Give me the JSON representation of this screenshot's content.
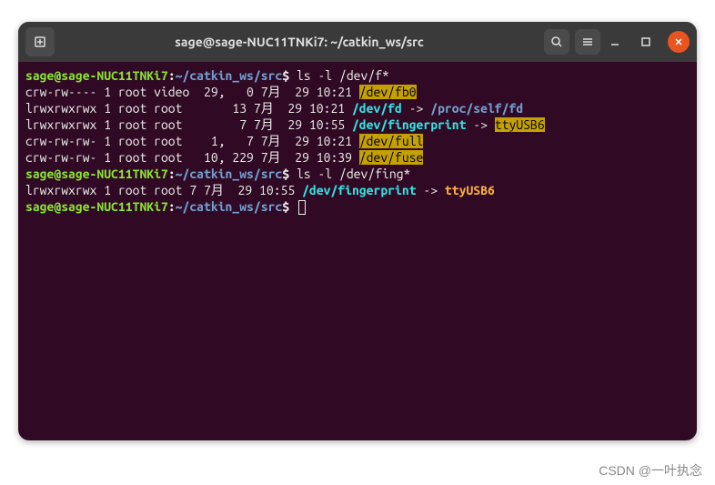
{
  "window": {
    "title": "sage@sage-NUC11TNKi7: ~/catkin_ws/src"
  },
  "prompt": {
    "user_host": "sage@sage-NUC11TNKi7",
    "sep1": ":",
    "path": "~/catkin_ws/src",
    "dollar": "$"
  },
  "commands": {
    "cmd1": " ls -l /dev/f*",
    "cmd2": " ls -l /dev/fing*"
  },
  "lines": {
    "l1_perm": "crw-rw---- 1 root video  29,   0 7月  29 10:21 ",
    "l1_file": "/dev/fb0",
    "l2_perm": "lrwxrwxrwx 1 root root       13 7月  29 10:21 ",
    "l2_file": "/dev/fd",
    "l2_arrow": " -> ",
    "l2_target": "/proc/self/fd",
    "l3_perm": "lrwxrwxrwx 1 root root        7 7月  29 10:55 ",
    "l3_file": "/dev/fingerprint",
    "l3_arrow": " -> ",
    "l3_target": "ttyUSB6",
    "l4_perm": "crw-rw-rw- 1 root root    1,   7 7月  29 10:21 ",
    "l4_file": "/dev/full",
    "l5_perm": "crw-rw-rw- 1 root root   10, 229 7月  29 10:39 ",
    "l5_file": "/dev/fuse",
    "l6_perm": "lrwxrwxrwx 1 root root 7 7月  29 10:55 ",
    "l6_file": "/dev/fingerprint",
    "l6_arrow": " -> ",
    "l6_target": "ttyUSB6"
  },
  "watermark": "CSDN @一叶执念"
}
